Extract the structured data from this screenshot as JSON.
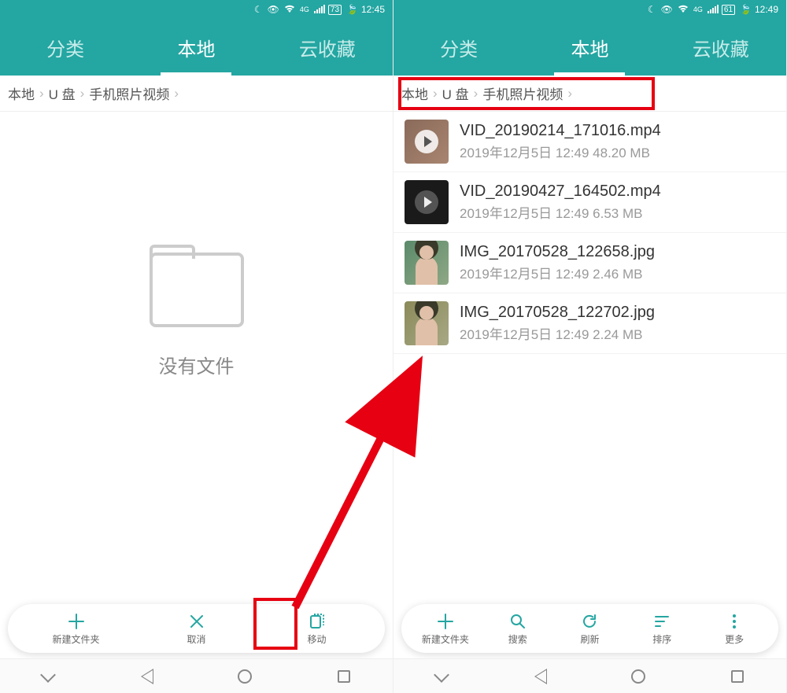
{
  "left": {
    "statusbar": {
      "battery": "73",
      "time": "12:45"
    },
    "tabs": {
      "category": "分类",
      "local": "本地",
      "cloud": "云收藏"
    },
    "breadcrumb": [
      "本地",
      "U 盘",
      "手机照片视频"
    ],
    "empty_text": "没有文件",
    "toolbar": [
      {
        "label": "新建文件夹",
        "kind": "plus"
      },
      {
        "label": "取消",
        "kind": "x"
      },
      {
        "label": "移动",
        "kind": "move"
      }
    ]
  },
  "right": {
    "statusbar": {
      "battery": "61",
      "time": "12:49"
    },
    "tabs": {
      "category": "分类",
      "local": "本地",
      "cloud": "云收藏"
    },
    "breadcrumb": [
      "本地",
      "U 盘",
      "手机照片视频"
    ],
    "files": [
      {
        "name": "VID_20190214_171016.mp4",
        "meta": "2019年12月5日 12:49 48.20 MB",
        "thumb": "vid1"
      },
      {
        "name": "VID_20190427_164502.mp4",
        "meta": "2019年12月5日 12:49 6.53 MB",
        "thumb": "vid2"
      },
      {
        "name": "IMG_20170528_122658.jpg",
        "meta": "2019年12月5日 12:49 2.46 MB",
        "thumb": "img1"
      },
      {
        "name": "IMG_20170528_122702.jpg",
        "meta": "2019年12月5日 12:49 2.24 MB",
        "thumb": "img2"
      }
    ],
    "toolbar": [
      {
        "label": "新建文件夹",
        "kind": "plus"
      },
      {
        "label": "搜索",
        "kind": "search"
      },
      {
        "label": "刷新",
        "kind": "refresh"
      },
      {
        "label": "排序",
        "kind": "sort"
      },
      {
        "label": "更多",
        "kind": "more"
      }
    ]
  }
}
